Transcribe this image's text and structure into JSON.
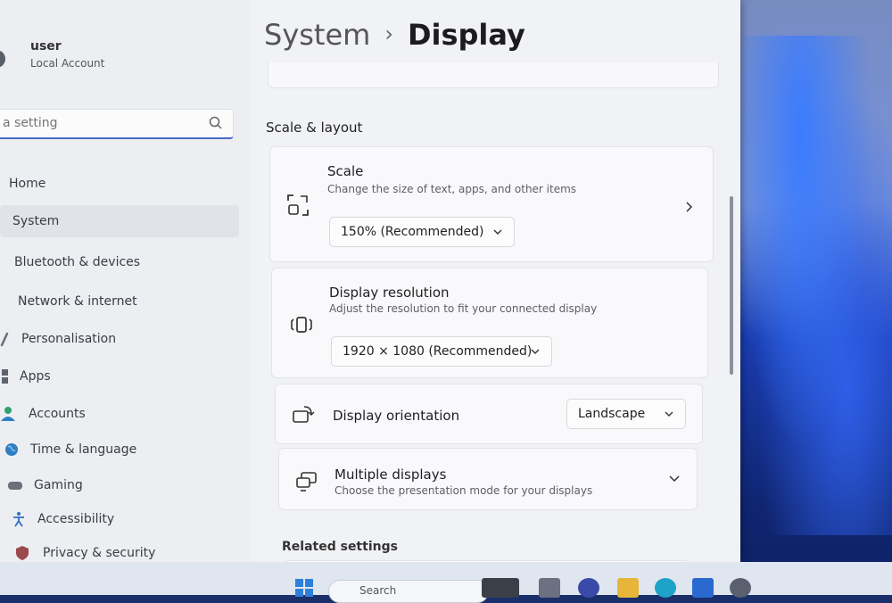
{
  "user": {
    "name": "user",
    "account_type": "Local Account"
  },
  "search": {
    "placeholder": "a setting"
  },
  "sidebar": {
    "items": [
      {
        "label": "Home",
        "icon": "home-icon"
      },
      {
        "label": "System",
        "icon": "system-icon",
        "selected": true
      },
      {
        "label": "Bluetooth & devices",
        "icon": "bluetooth-icon"
      },
      {
        "label": "Network & internet",
        "icon": "network-icon"
      },
      {
        "label": "Personalisation",
        "icon": "brush-icon"
      },
      {
        "label": "Apps",
        "icon": "apps-icon"
      },
      {
        "label": "Accounts",
        "icon": "accounts-icon"
      },
      {
        "label": "Time & language",
        "icon": "globe-icon"
      },
      {
        "label": "Gaming",
        "icon": "gamepad-icon"
      },
      {
        "label": "Accessibility",
        "icon": "accessibility-icon"
      },
      {
        "label": "Privacy & security",
        "icon": "shield-icon"
      }
    ]
  },
  "header": {
    "breadcrumb_parent": "System",
    "separator": "›",
    "title": "Display"
  },
  "section": {
    "title": "Scale & layout"
  },
  "scale": {
    "title": "Scale",
    "subtitle": "Change the size of text, apps, and other items",
    "value": "150% (Recommended)"
  },
  "resolution": {
    "title": "Display resolution",
    "subtitle": "Adjust the resolution to fit your connected display",
    "value": "1920 × 1080 (Recommended)"
  },
  "orientation": {
    "title": "Display orientation",
    "value": "Landscape"
  },
  "multiple": {
    "title": "Multiple displays",
    "subtitle": "Choose the presentation mode for your displays"
  },
  "related": {
    "title": "Related settings"
  },
  "taskbar": {
    "search_label": "Search"
  },
  "colors": {
    "accent": "#4a6bc4",
    "window_bg": "#f1f2f5",
    "wallpaper": "#1a3cb0"
  }
}
